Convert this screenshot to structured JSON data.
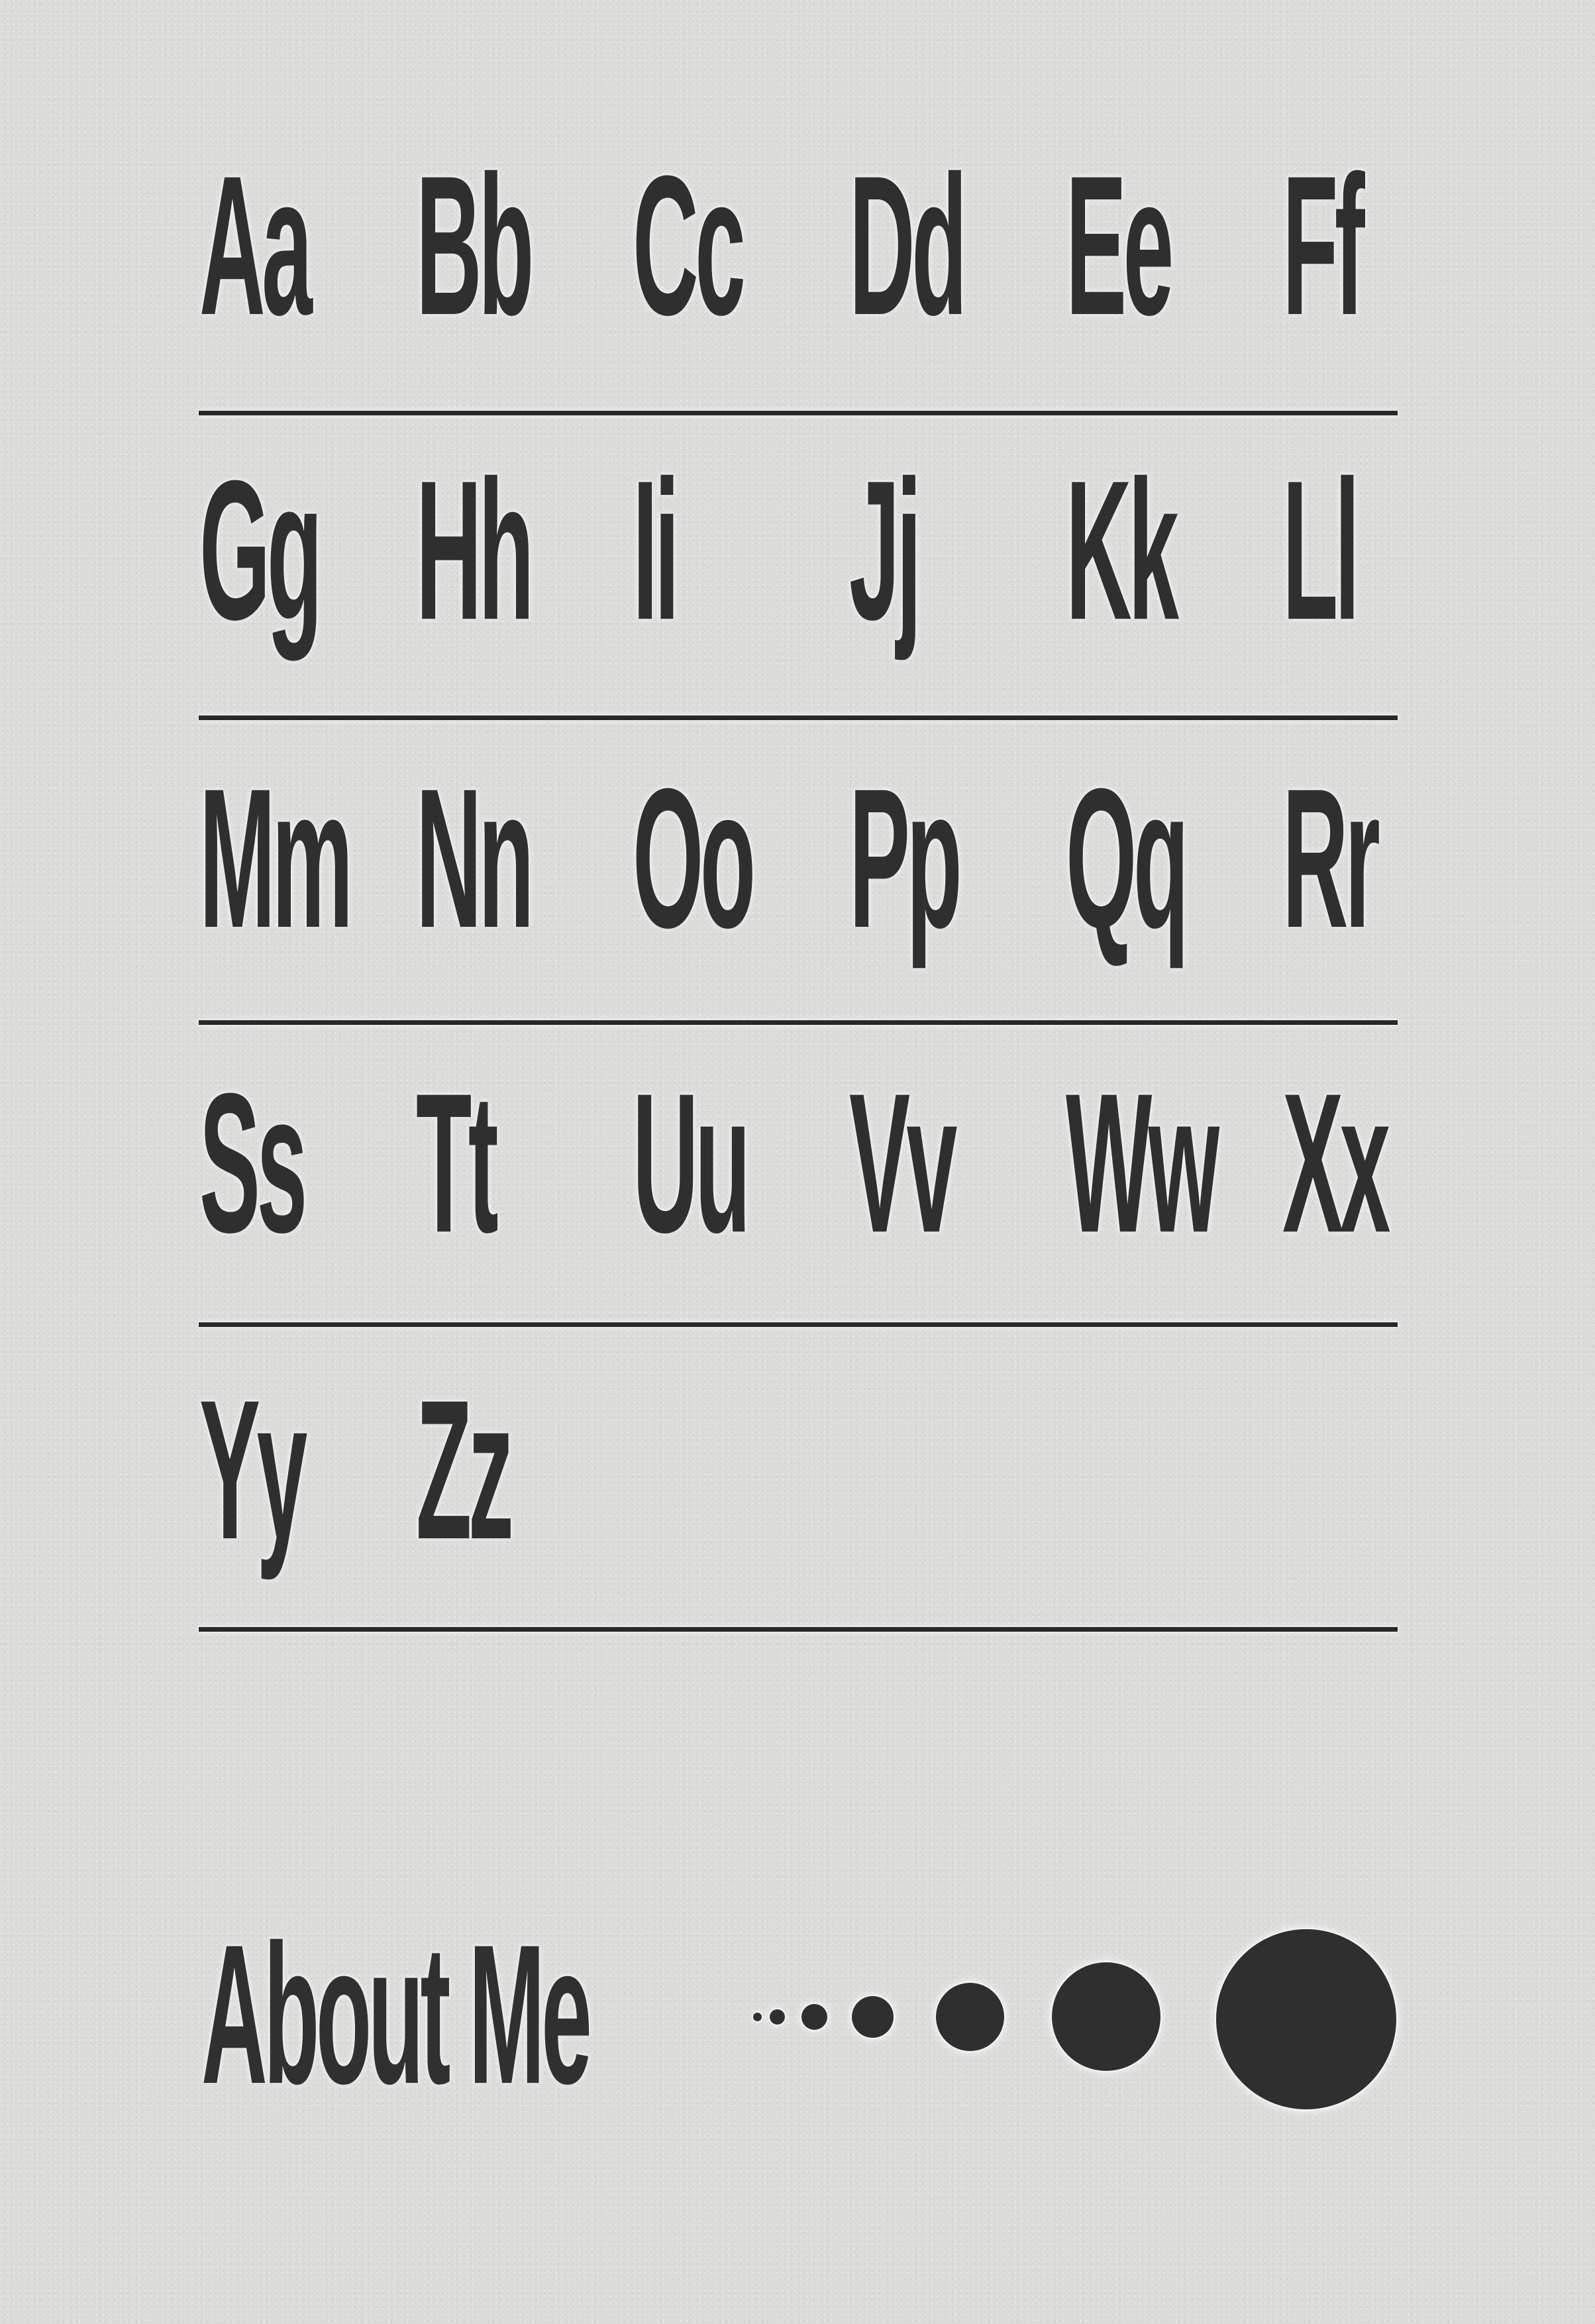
{
  "poster": {
    "rows": [
      [
        "Aa",
        "Bb",
        "Cc",
        "Dd",
        "Ee",
        "Ff"
      ],
      [
        "Gg",
        "Hh",
        "Ii",
        "Jj",
        "Kk",
        "Ll"
      ],
      [
        "Mm",
        "Nn",
        "Oo",
        "Pp",
        "Qq",
        "Rr"
      ],
      [
        "Ss",
        "Tt",
        "Uu",
        "Vv",
        "Ww",
        "Xx"
      ],
      [
        "Yy",
        "Zz"
      ]
    ],
    "about_title": "About Me",
    "colors": {
      "background": "#dcdcda",
      "ink": "#2f2f2f",
      "rule": "#282828"
    }
  }
}
